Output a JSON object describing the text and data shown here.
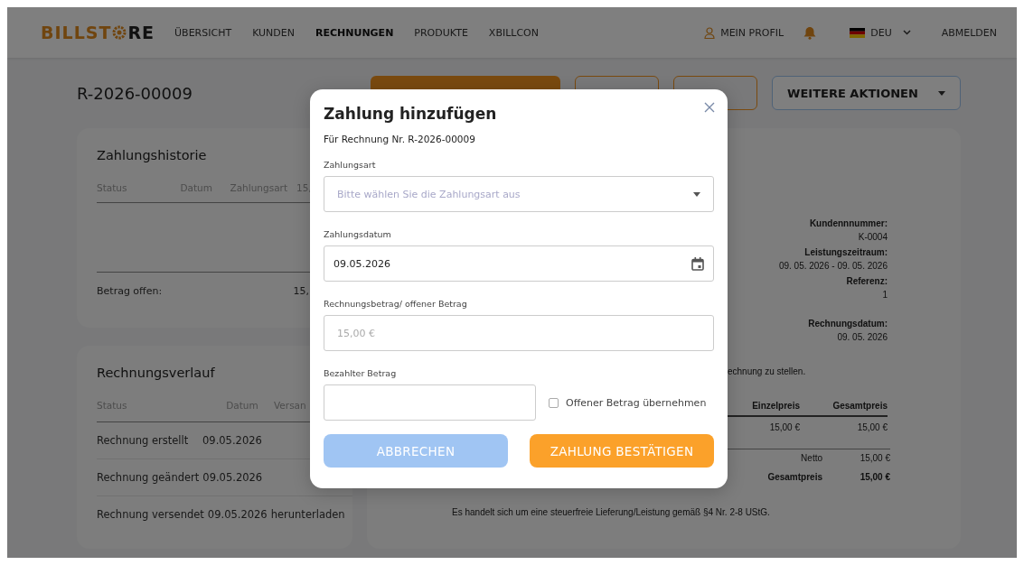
{
  "nav": {
    "logo_start": "BILLST",
    "logo_end": "RE",
    "items": [
      {
        "label": "ÜBERSICHT",
        "selected": false
      },
      {
        "label": "KUNDEN",
        "selected": false
      },
      {
        "label": "RECHNUNGEN",
        "selected": true
      },
      {
        "label": "PRODUKTE",
        "selected": false
      },
      {
        "label": "XBILLCON",
        "selected": false
      }
    ],
    "profile": "MEIN PROFIL",
    "language": "DEU",
    "logout": "ABMELDEN"
  },
  "invoice_number": "R-2026-00009",
  "actions": [
    {
      "kind": "filled"
    },
    {
      "kind": "outlined"
    },
    {
      "kind": "outlined"
    },
    {
      "kind": "menu",
      "label": "WEITERE AKTIONEN"
    }
  ],
  "payment_history": {
    "title": "Zahlungshistorie",
    "columns": [
      "Status",
      "Datum",
      "Zahlungsart",
      "15,"
    ],
    "footer_label": "Betrag offen:",
    "footer_value": "15,"
  },
  "invoice_history": {
    "title": "Rechnungsverlauf",
    "columns": [
      "Status",
      "Datum",
      "Versan"
    ],
    "rows": [
      [
        "Rechnung erstellt",
        "09.05.2026"
      ],
      [
        "Rechnung geändert",
        "09.05.2026"
      ],
      [
        "Rechnung versendet",
        "09.05.2026",
        "herunterladen"
      ]
    ]
  },
  "document": {
    "meta": [
      {
        "label": "Kundennnummer:",
        "value": "K-0004"
      },
      {
        "label": "Leistungszeitraum:",
        "value": "09. 05. 2026  -  09. 05. 2026"
      },
      {
        "label": "Referenz:",
        "value": "1"
      },
      {
        "label": "Rechnungsdatum:",
        "value": "09. 05. 2026"
      }
    ],
    "intro": "echnung zu stellen.",
    "columns": [
      "Einzelpreis",
      "Gesamtpreis"
    ],
    "rows": [
      [
        "15,00 €",
        "15,00 €"
      ]
    ],
    "totals": [
      {
        "label": "Netto",
        "value": "15,00 €",
        "bold": false
      },
      {
        "label": "Gesamtpreis",
        "value": "15,00 €",
        "bold": true
      }
    ],
    "note": "Es handelt sich um eine steuerfreie Lieferung/Leistung gemäß §4 Nr. 2-8 UStG."
  },
  "modal": {
    "title": "Zahlung hinzufügen",
    "subtitle": "Für Rechnung Nr. R-2026-00009",
    "fields": [
      {
        "kind": "select",
        "label": "Zahlungsart",
        "placeholder": "Bitte wählen Sie die Zahlungsart aus"
      },
      {
        "kind": "date",
        "label": "Zahlungsdatum",
        "value": "09.05.2026"
      },
      {
        "kind": "text",
        "label": "Rechnungsbetrag/ offener Betrag",
        "placeholder": "15,00 €"
      },
      {
        "kind": "amount",
        "label": "Bezahlter Betrag",
        "checkbox": {
          "label": "Offener Betrag übernehmen",
          "checked": false
        }
      }
    ],
    "buttons": [
      {
        "kind": "cancel",
        "label": "ABBRECHEN"
      },
      {
        "kind": "confirm",
        "label": "ZAHLUNG BESTÄTIGEN"
      }
    ]
  }
}
